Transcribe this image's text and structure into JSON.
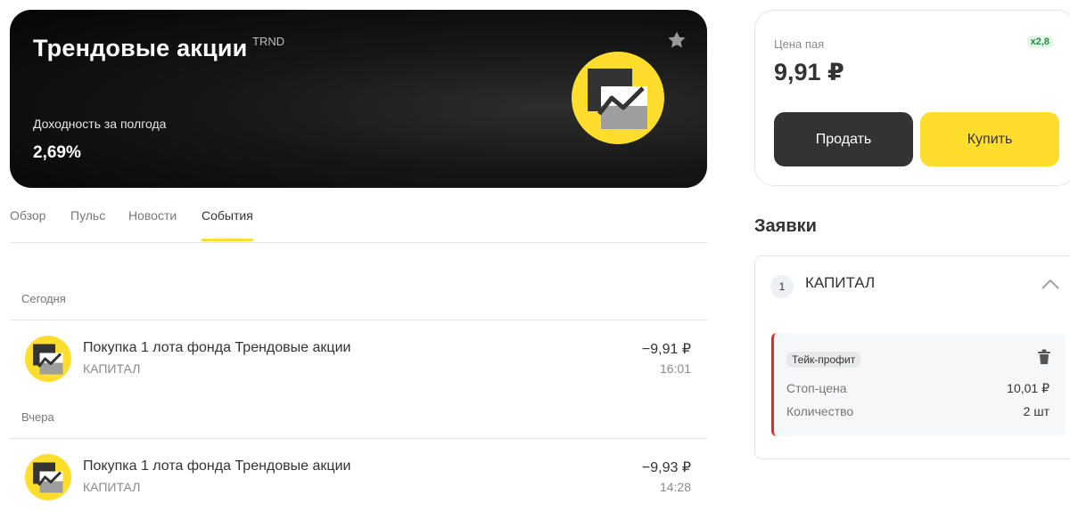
{
  "hero": {
    "title": "Трендовые акции",
    "ticker": "TRND",
    "yield_label": "Доходность за полгода",
    "yield_value": "2,69%",
    "icons": {
      "favorite": "star-icon",
      "logo": "trend-fund-logo"
    }
  },
  "tabs": [
    {
      "label": "Обзор",
      "active": false
    },
    {
      "label": "Пульс",
      "active": false
    },
    {
      "label": "Новости",
      "active": false
    },
    {
      "label": "События",
      "active": true
    }
  ],
  "events": {
    "groups": [
      {
        "label": "Сегодня",
        "items": [
          {
            "title": "Покупка 1 лота фонда Трендовые акции",
            "account": "КАПИТАЛ",
            "amount": "−9,91 ₽",
            "time": "16:01"
          }
        ]
      },
      {
        "label": "Вчера",
        "items": [
          {
            "title": "Покупка 1 лота фонда Трендовые акции",
            "account": "КАПИТАЛ",
            "amount": "−9,93 ₽",
            "time": "14:28"
          }
        ]
      }
    ]
  },
  "price_card": {
    "label": "Цена пая",
    "value": "9,91 ₽",
    "leverage": "x2,8",
    "sell_label": "Продать",
    "buy_label": "Купить"
  },
  "orders": {
    "heading": "Заявки",
    "account_number": "1",
    "account_name": "КАПИТАЛ",
    "order": {
      "type": "Тейк-профит",
      "stop_price_label": "Стоп-цена",
      "stop_price_value": "10,01 ₽",
      "quantity_label": "Количество",
      "quantity_value": "2 шт"
    }
  },
  "colors": {
    "accent": "#ffdd2d",
    "dark": "#333333",
    "order_marker": "#dd2d2d",
    "leverage_bg": "#e2f6e6",
    "leverage_text": "#2a8a46"
  }
}
